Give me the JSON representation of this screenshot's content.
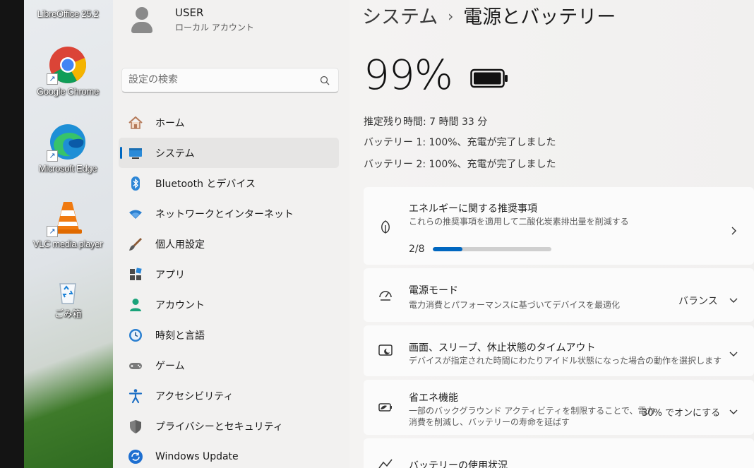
{
  "desktop": {
    "icons": [
      {
        "label": "LibreOffice 25.2"
      },
      {
        "label": "Google Chrome"
      },
      {
        "label": "Microsoft Edge"
      },
      {
        "label": "VLC media player"
      },
      {
        "label": "ごみ箱"
      }
    ]
  },
  "sidebar": {
    "user_name": "USER",
    "user_sub": "ローカル アカウント",
    "search_placeholder": "設定の検索",
    "items": [
      {
        "label": "ホーム",
        "icon": "home-icon"
      },
      {
        "label": "システム",
        "icon": "system-icon"
      },
      {
        "label": "Bluetooth とデバイス",
        "icon": "bluetooth-icon"
      },
      {
        "label": "ネットワークとインターネット",
        "icon": "wifi-icon"
      },
      {
        "label": "個人用設定",
        "icon": "brush-icon"
      },
      {
        "label": "アプリ",
        "icon": "apps-icon"
      },
      {
        "label": "アカウント",
        "icon": "account-icon"
      },
      {
        "label": "時刻と言語",
        "icon": "clock-globe-icon"
      },
      {
        "label": "ゲーム",
        "icon": "gamepad-icon"
      },
      {
        "label": "アクセシビリティ",
        "icon": "accessibility-icon"
      },
      {
        "label": "プライバシーとセキュリティ",
        "icon": "shield-icon"
      },
      {
        "label": "Windows Update",
        "icon": "update-icon"
      }
    ],
    "active_index": 1
  },
  "main": {
    "breadcrumb_parent": "システム",
    "breadcrumb_sep": "›",
    "breadcrumb_current": "電源とバッテリー",
    "battery_percent": "99%",
    "battery_level": 0.99,
    "remaining": "推定残り時間: 7 時間 33 分",
    "battery1": "バッテリー 1: 100%、充電が完了しました",
    "battery2": "バッテリー 2: 100%、充電が完了しました",
    "cards": {
      "energy": {
        "title": "エネルギーに関する推奨事項",
        "subtitle": "これらの推奨事項を適用して二酸化炭素排出量を削減する",
        "progress_text": "2/8",
        "progress_fraction": 0.25
      },
      "power_mode": {
        "title": "電源モード",
        "subtitle": "電力消費とパフォーマンスに基づいてデバイスを最適化",
        "value": "バランス"
      },
      "screen_sleep": {
        "title": "画面、スリープ、休止状態のタイムアウト",
        "subtitle": "デバイスが指定された時間にわたりアイドル状態になった場合の動作を選択します"
      },
      "energy_saver": {
        "title": "省エネ機能",
        "subtitle1": "一部のバックグラウンド アクティビティを制限することで、電力",
        "subtitle2": "消費を削減し、バッテリーの寿命を延ばす",
        "value": "30% でオンにする"
      },
      "usage": {
        "title": "バッテリーの使用状況"
      }
    }
  },
  "colors": {
    "accent": "#0067c0",
    "sidebar_bg": "#f2f1f0",
    "card_bg": "#fbfbfb"
  }
}
